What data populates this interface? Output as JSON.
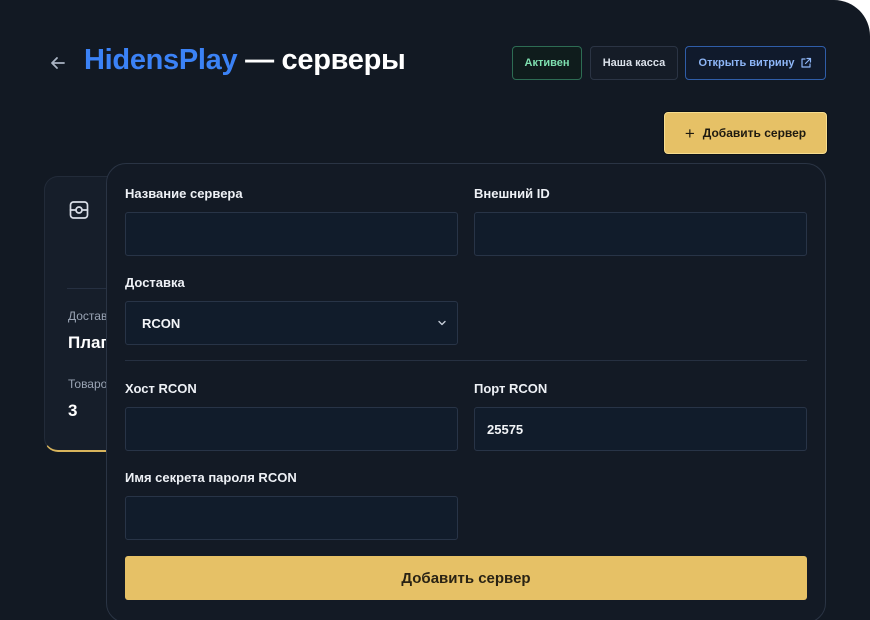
{
  "header": {
    "brand": "HidensPlay",
    "title_suffix": " — серверы",
    "status_badge": "Активен",
    "checkout_label": "Наша касса",
    "open_store_label": "Открыть витрину"
  },
  "actions": {
    "add_server_label": "Добавить сервер"
  },
  "server_card": {
    "delivery_label": "Достав",
    "delivery_value": "Плаг",
    "products_label": "Товаро",
    "products_value": "3"
  },
  "form": {
    "server_name_label": "Название сервера",
    "server_name_value": "",
    "external_id_label": "Внешний ID",
    "external_id_value": "",
    "delivery_label": "Доставка",
    "delivery_selected": "RCON",
    "rcon_host_label": "Хост RCON",
    "rcon_host_value": "",
    "rcon_port_label": "Порт RCON",
    "rcon_port_value": "25575",
    "rcon_secret_label": "Имя секрета пароля RCON",
    "rcon_secret_value": "",
    "submit_label": "Добавить сервер"
  },
  "colors": {
    "background": "#121923",
    "brand": "#3b82f6",
    "accent": "#e6c166",
    "active_badge": "#7fe0b0",
    "link": "#8eb6f7"
  },
  "icons": {
    "back": "arrow-left-icon",
    "external": "external-link-icon",
    "plus": "plus-icon",
    "server": "server-icon",
    "chevron": "chevron-down-icon"
  }
}
